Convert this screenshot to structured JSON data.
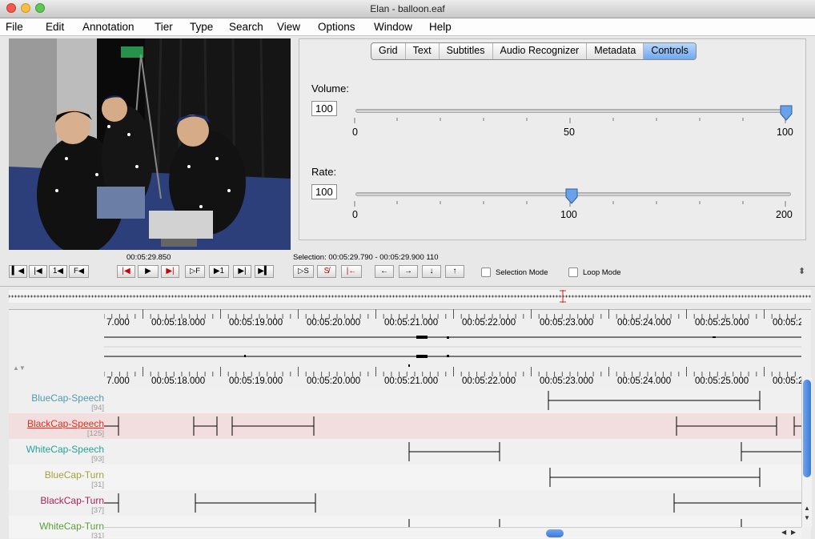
{
  "window": {
    "title": "Elan - balloon.eaf"
  },
  "menu": [
    "File",
    "Edit",
    "Annotation",
    "Tier",
    "Type",
    "Search",
    "View",
    "Options",
    "Window",
    "Help"
  ],
  "tabs": [
    {
      "label": "Grid",
      "active": false
    },
    {
      "label": "Text",
      "active": false
    },
    {
      "label": "Subtitles",
      "active": false
    },
    {
      "label": "Audio Recognizer",
      "active": false
    },
    {
      "label": "Metadata",
      "active": false
    },
    {
      "label": "Controls",
      "active": true
    }
  ],
  "controls": {
    "volume": {
      "label": "Volume:",
      "value": "100",
      "min": "0",
      "mid": "50",
      "max": "100",
      "level": 1.0
    },
    "rate": {
      "label": "Rate:",
      "value": "100",
      "min": "0",
      "mid": "100",
      "max": "200",
      "level": 0.5
    }
  },
  "media": {
    "current_time": "00:05:29.850"
  },
  "selection": {
    "text": "Selection: 00:05:29.790 - 00:05:29.900  110"
  },
  "transport": {
    "buttons": [
      "go-to-begin",
      "previous-scrollview",
      "prev-frame-second",
      "previous-frame",
      "prev-pixel",
      "play",
      "next-pixel",
      "next-frame",
      "next-frame-second",
      "next-scrollview",
      "go-to-end"
    ],
    "labels": {
      "b3": "1◀",
      "b4": "F◀",
      "b8": "▷F",
      "b9": "▶1"
    },
    "play_selection": "▷S",
    "selection_mode": "Selection Mode",
    "loop_mode": "Loop Mode"
  },
  "ruler_ticks": [
    "7.000",
    "00:05:18.000",
    "00:05:19.000",
    "00:05:20.000",
    "00:05:21.000",
    "00:05:22.000",
    "00:05:23.000",
    "00:05:24.000",
    "00:05:25.000",
    "00:05:2"
  ],
  "tiers": [
    {
      "name": "BlueCap-Speech",
      "count": "[94]",
      "color": "#4f9bb0",
      "bg": "#f0f0f0"
    },
    {
      "name": "BlackCap-Speech",
      "count": "[125]",
      "color": "#e0301e",
      "bg": "#f2dede"
    },
    {
      "name": "WhiteCap-Speech",
      "count": "[93]",
      "color": "#23a39a",
      "bg": "#f0f0f0"
    },
    {
      "name": "BlueCap-Turn",
      "count": "[31]",
      "color": "#a3a33a",
      "bg": "#f4f4f4"
    },
    {
      "name": "BlackCap-Turn",
      "count": "[37]",
      "color": "#b0205a",
      "bg": "#f0f0f0"
    },
    {
      "name": "WhiteCap-Turn",
      "count": "[31]",
      "color": "#5aa035",
      "bg": "#f4f4f4"
    }
  ]
}
